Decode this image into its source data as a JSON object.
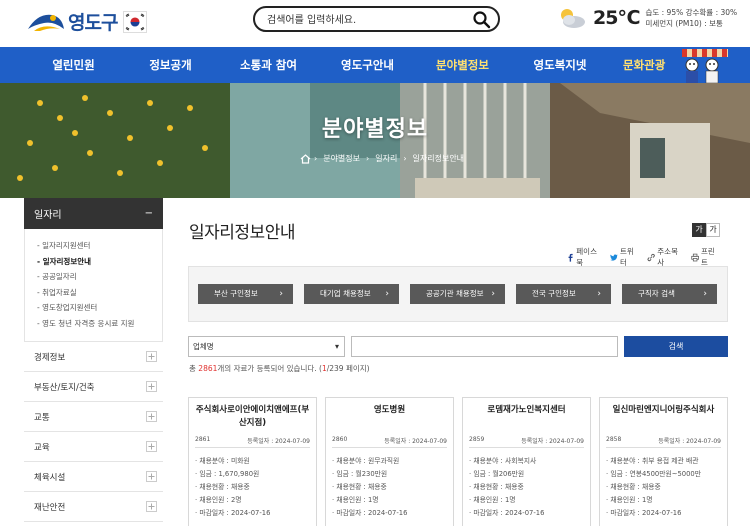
{
  "header": {
    "logo_text": "영도구",
    "search_placeholder": "검색어를 입력하세요.",
    "weather": {
      "temp": "25℃",
      "line1": "습도 : 95%   강수확률 : 30%",
      "line2": "미세먼지 (PM10) : 보통"
    }
  },
  "nav": {
    "items": [
      "열린민원",
      "정보공개",
      "소통과 참여",
      "영도구안내",
      "분야별정보",
      "영도복지넷",
      "문화관광"
    ],
    "active_index": 4
  },
  "banner": {
    "title": "분야별정보",
    "breadcrumb": [
      "분야별정보",
      "일자리",
      "일자리정보안내"
    ]
  },
  "sidebar": {
    "section_title": "일자리",
    "section_toggle": "−",
    "sub_items": [
      "일자리지원센터",
      "일자리정보안내",
      "공공일자리",
      "취업자료실",
      "영도창업지원센터",
      "영도 청년 자격증 응시료 지원"
    ],
    "active_sub_index": 1,
    "menu_items": [
      "경제정보",
      "부동산/토지/건축",
      "교통",
      "교육",
      "체육시설",
      "재난안전"
    ]
  },
  "content": {
    "title": "일자리정보안내",
    "font_controls": [
      "가",
      "가"
    ],
    "share": [
      "페이스북",
      "트위터",
      "주소복사",
      "프린트"
    ],
    "quick_links": [
      "부산 구인정보",
      "대기업 채용정보",
      "공공기관 채용정보",
      "전국 구인정보",
      "구직자 검색"
    ],
    "filter": {
      "select_value": "업체명",
      "button": "검색"
    },
    "count": {
      "prefix": "총 ",
      "total": "2861",
      "middle": "개의 자료가 등록되어 있습니다. (",
      "page": "1",
      "suffix": "/239 페이지)"
    },
    "cards": [
      {
        "title": "주식회사로이안에이치앤에프(부산지점)",
        "num": "2861",
        "date": "등록일자 : 2024-07-09",
        "rows": [
          "· 채용분야 : 미화원",
          "· 임금 : 1,670,980원",
          "· 채용현황 : 채용중",
          "· 채용인원 : 2명",
          "· 마감일자 : 2024-07-16"
        ]
      },
      {
        "title": "영도병원",
        "num": "2860",
        "date": "등록일자 : 2024-07-09",
        "rows": [
          "· 채용분야 : 원무과직원",
          "· 임금 : 월230만원",
          "· 채용현황 : 채용중",
          "· 채용인원 : 1명",
          "· 마감일자 : 2024-07-16"
        ]
      },
      {
        "title": "로뎀재가노인복지센터",
        "num": "2859",
        "date": "등록일자 : 2024-07-09",
        "rows": [
          "· 채용분야 : 사회복지사",
          "· 임금 : 월206만원",
          "· 채용현황 : 채용중",
          "· 채용인원 : 1명",
          "· 마감일자 : 2024-07-16"
        ]
      },
      {
        "title": "일신마린엔지니어링주식회사",
        "num": "2858",
        "date": "등록일자 : 2024-07-09",
        "rows": [
          "· 채용분야 : 취부 용접 제관 배관",
          "· 임금 : 연봉4500만원~5000만",
          "· 채용현황 : 채용중",
          "· 채용인원 : 1명",
          "· 마감일자 : 2024-07-16"
        ]
      }
    ]
  },
  "colors": {
    "nav_bg": "#1f5fc7",
    "active_nav": "#ffe070",
    "search_button": "#1c4da0",
    "count_highlight": "#e0312f"
  }
}
